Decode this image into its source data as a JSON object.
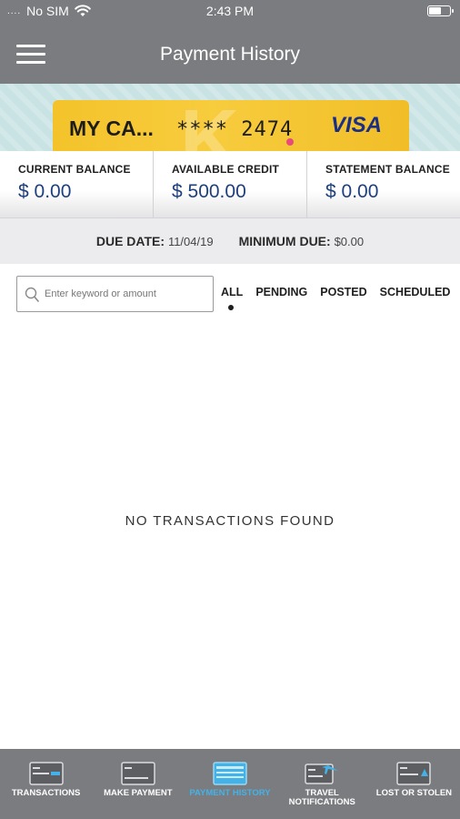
{
  "status_bar": {
    "dots": "....",
    "carrier": "No SIM",
    "time": "2:43 PM",
    "battery_level": 0.55
  },
  "nav": {
    "title": "Payment History"
  },
  "card": {
    "name": "MY CA...",
    "number": "**** 2474",
    "brand": "VISA"
  },
  "balances": [
    {
      "label": "CURRENT BALANCE",
      "value": "$ 0.00"
    },
    {
      "label": "AVAILABLE CREDIT",
      "value": "$ 500.00"
    },
    {
      "label": "STATEMENT BALANCE",
      "value": "$ 0.00"
    }
  ],
  "due": {
    "date_label": "DUE DATE:",
    "date_value": "11/04/19",
    "min_label": "MINIMUM DUE:",
    "min_value": "$0.00"
  },
  "search": {
    "placeholder": "Enter keyword or amount"
  },
  "filters": [
    "ALL",
    "PENDING",
    "POSTED",
    "SCHEDULED"
  ],
  "empty_message": "NO TRANSACTIONS FOUND",
  "tabbar": [
    {
      "label": "TRANSACTIONS"
    },
    {
      "label": "MAKE PAYMENT"
    },
    {
      "label": "PAYMENT HISTORY"
    },
    {
      "label": "TRAVEL NOTIFICATIONS"
    },
    {
      "label": "LOST OR STOLEN"
    }
  ],
  "colors": {
    "header_gray": "#7b7c80",
    "active_tab": "#44b2e6",
    "balance_blue": "#1e3f7e",
    "card_yellow": "#f4c32b"
  }
}
